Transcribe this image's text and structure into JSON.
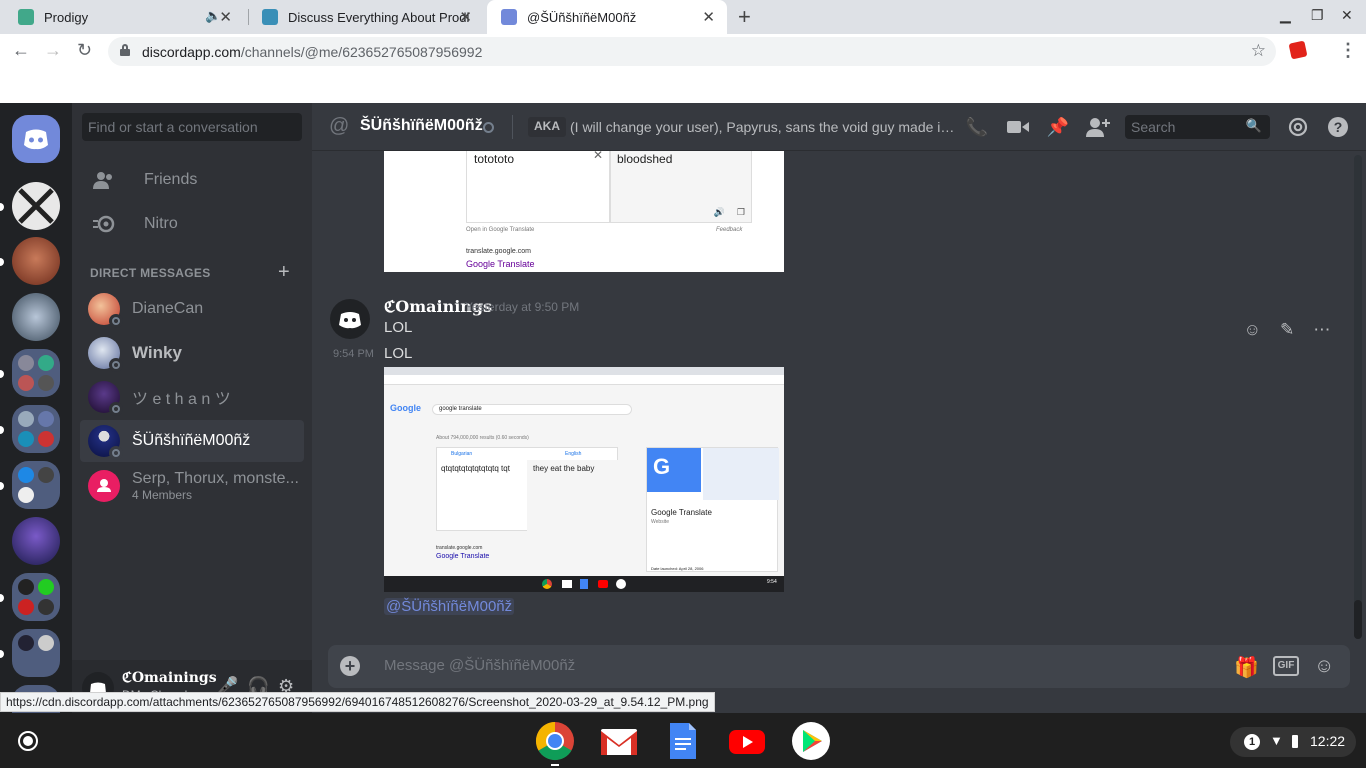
{
  "browser": {
    "tabs": [
      {
        "title": "Prodigy"
      },
      {
        "title": "Discuss Everything About Prodig"
      },
      {
        "title": "@ŠÜñšhïñëM00ñž"
      }
    ],
    "url_host": "discordapp.com",
    "url_path": "/channels/@me/623652765087956992",
    "status_url": "https://cdn.discordapp.com/attachments/623652765087956992/694016748512608276/Screenshot_2020-03-29_at_9.54.12_PM.png"
  },
  "sidebar": {
    "search_placeholder": "Find or start a conversation",
    "nav": [
      {
        "label": "Friends",
        "icon": "friends-icon"
      },
      {
        "label": "Nitro",
        "icon": "nitro-icon"
      }
    ],
    "dm_header": "DIRECT MESSAGES",
    "dms": [
      {
        "name": "DianeCan",
        "color": "#c0392b"
      },
      {
        "name": "Winky",
        "color": "#7a8fb5"
      },
      {
        "name": "ツ e t h a n ツ",
        "color": "#2c1a4d"
      },
      {
        "name": "ŠÜñšhïñëM00ñž",
        "color": "#1f2b7a"
      },
      {
        "name": "Serp, Thorux, monste...",
        "sub": "4 Members",
        "color": "#e91e63"
      }
    ]
  },
  "user_panel": {
    "name": "ℭOmainings",
    "status": "DMs Closed"
  },
  "channel": {
    "name": "ŠÜñšhïñëM00ñž",
    "aka_label": "AKA",
    "aka_text": "(I will change your user), Papyrus, sans the void guy made in voi...",
    "search_placeholder": "Search"
  },
  "messages": {
    "embed1": {
      "source_text": "totototo",
      "translated_text": "bloodshed",
      "open_link": "Open in Google Translate",
      "feedback": "Feedback",
      "site": "translate.google.com",
      "title": "Google Translate"
    },
    "author": "ℭOmainings",
    "timestamp": "Yesterday at 9:50 PM",
    "text1": "LOL",
    "time2": "9:54 PM",
    "text2": "LOL",
    "embed2": {
      "query": "google translate",
      "results": "About 794,000,000 results (0.60 seconds)",
      "src_lang": "Bulgarian",
      "dst_lang": "English",
      "src_text": "qtqtqtqtqtqtqtqtq tqt",
      "dst_text": "they eat the baby",
      "site": "translate.google.com",
      "title": "Google Translate",
      "kp_title": "Google Translate",
      "kp_sub": "Website",
      "kp_date": "Date launched: April 28, 2006",
      "time": "9:54"
    },
    "mention": "@ŠÜñšhïñëM00ñž"
  },
  "composer": {
    "placeholder": "Message @ŠÜñšhïñëM00ñž",
    "gif_label": "GIF"
  },
  "shelf": {
    "notification_count": "1",
    "clock": "12:22"
  },
  "colors": {
    "discord_blurple": "#7289da",
    "bg": "#36393f"
  }
}
